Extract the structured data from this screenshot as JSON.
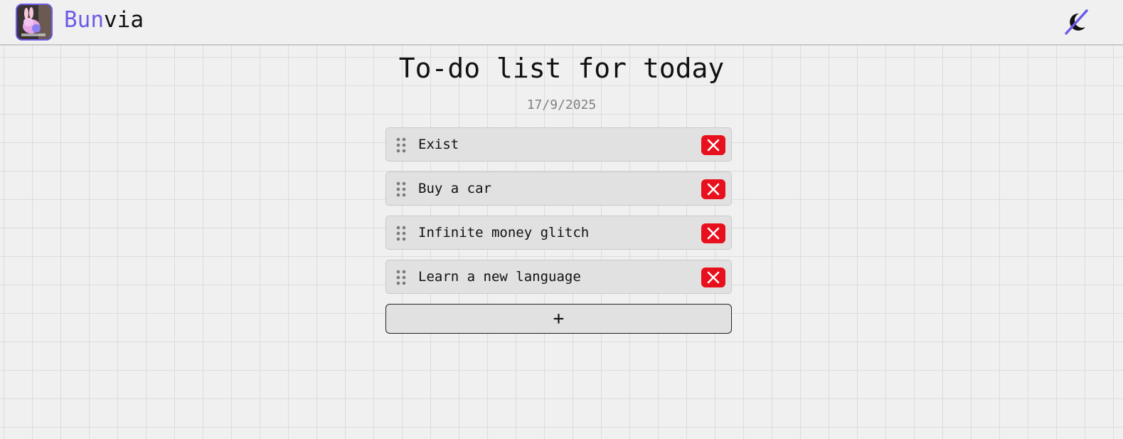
{
  "header": {
    "brand_part1": "Bun",
    "brand_part2": "via",
    "logo_icon": "bunny-avatar-icon",
    "theme_toggle_icon": "moon-slashed-icon",
    "accent_color": "#6b5ce7"
  },
  "main": {
    "title": "To-do list for today",
    "date": "17/9/2025",
    "items": [
      {
        "label": "Exist"
      },
      {
        "label": "Buy a car"
      },
      {
        "label": "Infinite money glitch"
      },
      {
        "label": "Learn a new language"
      }
    ],
    "add_label": "+",
    "delete_color": "#e8101c"
  }
}
